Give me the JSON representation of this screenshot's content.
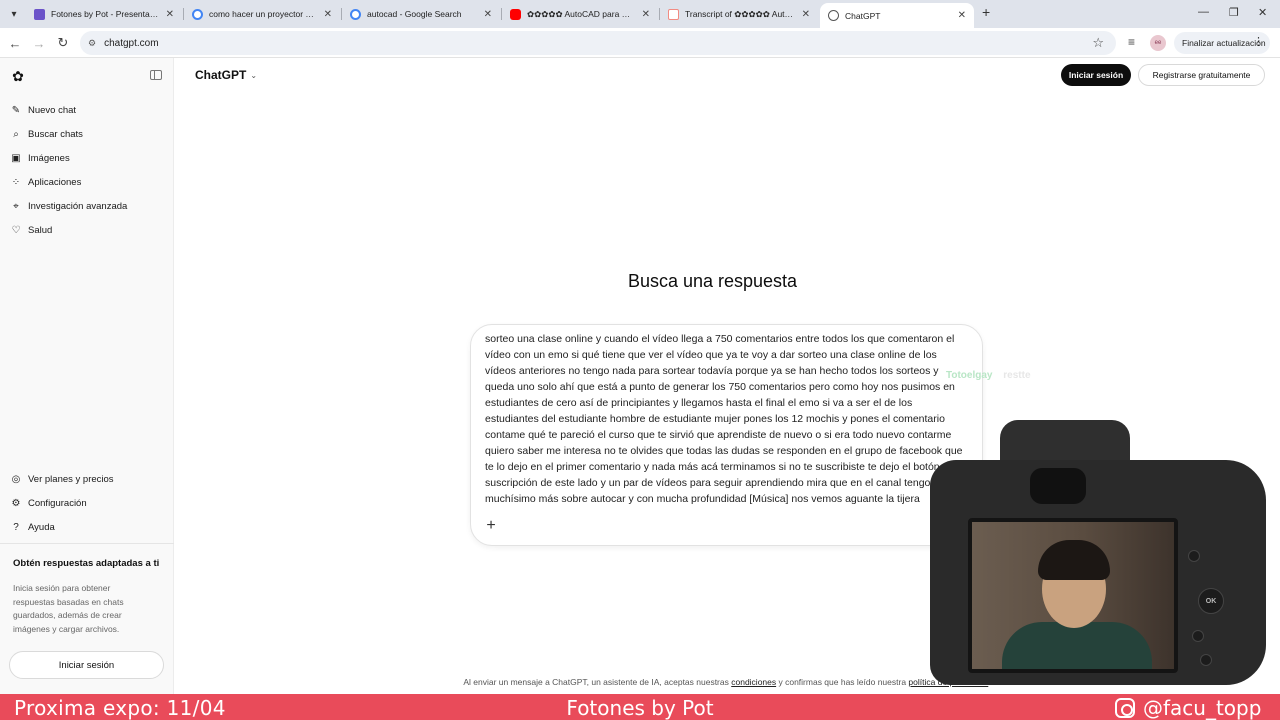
{
  "browser": {
    "tabs": [
      {
        "title": "Fotones by Pot - Presentación",
        "favicon_color": "#6b53c9",
        "active": false
      },
      {
        "title": "como hacer un proyector casero",
        "favicon_color": "#4285f4",
        "active": false
      },
      {
        "title": "autocad - Google Search",
        "favicon_color": "#4285f4",
        "active": false
      },
      {
        "title": "✿✿✿✿✿ AutoCAD para Principiantes",
        "favicon_color": "#ff0000",
        "active": false
      },
      {
        "title": "Transcript of ✿✿✿✿✿ AutoCAD",
        "favicon_color": "#f28b82",
        "active": false
      },
      {
        "title": "ChatGPT",
        "favicon_color": "#555555",
        "active": true
      }
    ],
    "new_tab_label": "+",
    "address": "chatgpt.com",
    "update_button": "Finalizar actualización",
    "profile_initials": "ee"
  },
  "sidebar": {
    "items": [
      {
        "icon": "edit-icon",
        "label": "Nuevo chat"
      },
      {
        "icon": "search-icon",
        "label": "Buscar chats"
      },
      {
        "icon": "image-icon",
        "label": "Imágenes"
      },
      {
        "icon": "apps-icon",
        "label": "Aplicaciones"
      },
      {
        "icon": "telescope-icon",
        "label": "Investigación avanzada"
      },
      {
        "icon": "heart-icon",
        "label": "Salud"
      }
    ],
    "bottom_items": [
      {
        "icon": "plans-icon",
        "label": "Ver planes y precios"
      },
      {
        "icon": "settings-icon",
        "label": "Configuración"
      },
      {
        "icon": "help-icon",
        "label": "Ayuda"
      }
    ],
    "promo_title": "Obtén respuestas adaptadas a ti",
    "promo_text": "Inicia sesión para obtener respuestas basadas en chats guardados, además de crear imágenes y cargar archivos.",
    "login_button": "Iniciar sesión"
  },
  "header": {
    "model": "ChatGPT",
    "login_button": "Iniciar sesión",
    "register_button": "Registrarse gratuitamente"
  },
  "main": {
    "headline": "Busca una respuesta",
    "composer_text": "sorteo una clase online y cuando el vídeo llega a 750 comentarios entre todos los que comentaron el vídeo con un emo si qué tiene que ver el vídeo que ya te voy a dar sorteo una clase online de los vídeos anteriores no tengo nada para sortear todavía porque ya se han hecho todos los sorteos y queda uno solo ahí que está a punto de generar los 750 comentarios pero como hoy nos pusimos en estudiantes de cero así de principiantes y llegamos hasta el final el emo si va a ser el de los estudiantes del estudiante hombre de estudiante mujer pones los 12 mochis y pones el comentario contame qué te pareció el curso que te sirvió que aprendiste de nuevo o si era todo nuevo contarme quiero saber me interesa no te olvides que todas las dudas se responden en el grupo de facebook que te lo dejo en el primer comentario y nada más acá terminamos si no te suscribiste te dejo el botón de suscripción de este lado y un par de vídeos para seguir aprendiendo mira que en el canal tengo muchísimo más sobre autocar y con mucha profundidad [Música] nos vemos aguante la tijera",
    "disclaimer_prefix": "Al enviar un mensaje a ChatGPT, un asistente de IA, aceptas nuestras ",
    "disclaimer_terms": "condiciones",
    "disclaimer_middle": " y confirmas que has leído nuestra ",
    "disclaimer_privacy": "política de privacidad",
    "disclaimer_suffix": "."
  },
  "overlay": {
    "watermark_main": "Totoelgay",
    "watermark_sub": "restte",
    "camera_ok_label": "OK",
    "banner_left": "Proxima expo: 11/04",
    "banner_center": "Fotones by Pot",
    "banner_right": "@facu_topp",
    "banner_color": "#e94b5a"
  }
}
